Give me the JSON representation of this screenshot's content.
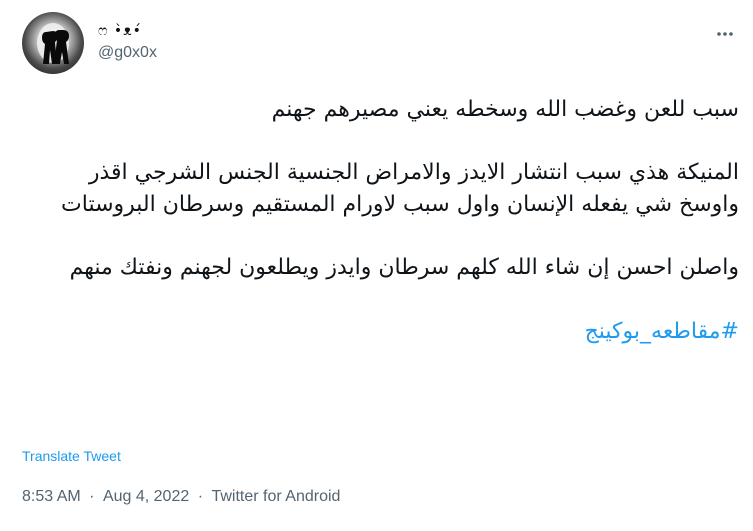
{
  "user": {
    "display_name": "ෆ •̀ᴥ•́",
    "handle": "@g0x0x"
  },
  "tweet": {
    "para1": "سبب للعن وغضب الله وسخطه يعني مصيرهم جهنم",
    "para2": "المنيكة هذي سبب انتشار الايدز والامراض الجنسية الجنس الشرجي اقذر واوسخ شي يفعله الإنسان واول سبب لاورام المستقيم وسرطان البروستات",
    "para3": "واصلن احسن إن شاء الله كلهم سرطان وايدز ويطلعون لجهنم ونفتك منهم",
    "hashtag": "#مقاطعه_بوكينج"
  },
  "actions": {
    "translate_label": "Translate Tweet"
  },
  "meta": {
    "time": "8:53 AM",
    "separator": "·",
    "date": "Aug 4, 2022",
    "source": "Twitter for Android"
  },
  "icons": {
    "more": "more-horizontal-icon"
  },
  "colors": {
    "link": "#1d9bf0",
    "secondary_text": "#536471",
    "primary_text": "#0f1419"
  }
}
